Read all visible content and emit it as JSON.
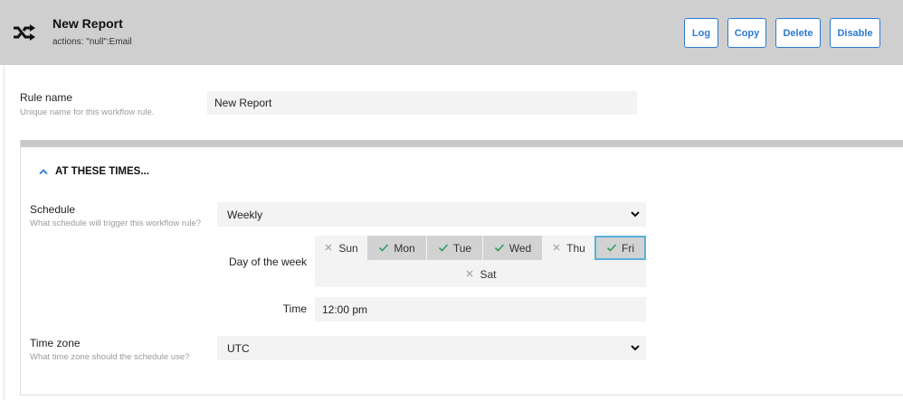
{
  "header": {
    "title": "New Report",
    "subtitle": "actions: \"null\":Email",
    "icon": "shuffle-icon",
    "buttons": {
      "log": "Log",
      "copy": "Copy",
      "delete": "Delete",
      "disable": "Disable"
    }
  },
  "rule_name": {
    "label": "Rule name",
    "help": "Unique name for this workflow rule.",
    "value": "New Report"
  },
  "section": {
    "heading": "AT THESE TIMES...",
    "schedule": {
      "label": "Schedule",
      "help": "What schedule will trigger this workflow rule?",
      "value": "Weekly"
    },
    "day_of_week": {
      "label": "Day of the week",
      "days": [
        {
          "name": "Sun",
          "selected": false
        },
        {
          "name": "Mon",
          "selected": true
        },
        {
          "name": "Tue",
          "selected": true
        },
        {
          "name": "Wed",
          "selected": true
        },
        {
          "name": "Thu",
          "selected": false
        },
        {
          "name": "Fri",
          "selected": true
        },
        {
          "name": "Sat",
          "selected": false
        }
      ]
    },
    "time": {
      "label": "Time",
      "value": "12:00 pm"
    },
    "time_zone": {
      "label": "Time zone",
      "help": "What time zone should the schedule use?",
      "value": "UTC"
    }
  },
  "colors": {
    "accent": "#2b7bd1",
    "check": "#2e9d5e",
    "focus": "#5ab0dc",
    "header_bg": "#cfcfcf"
  }
}
